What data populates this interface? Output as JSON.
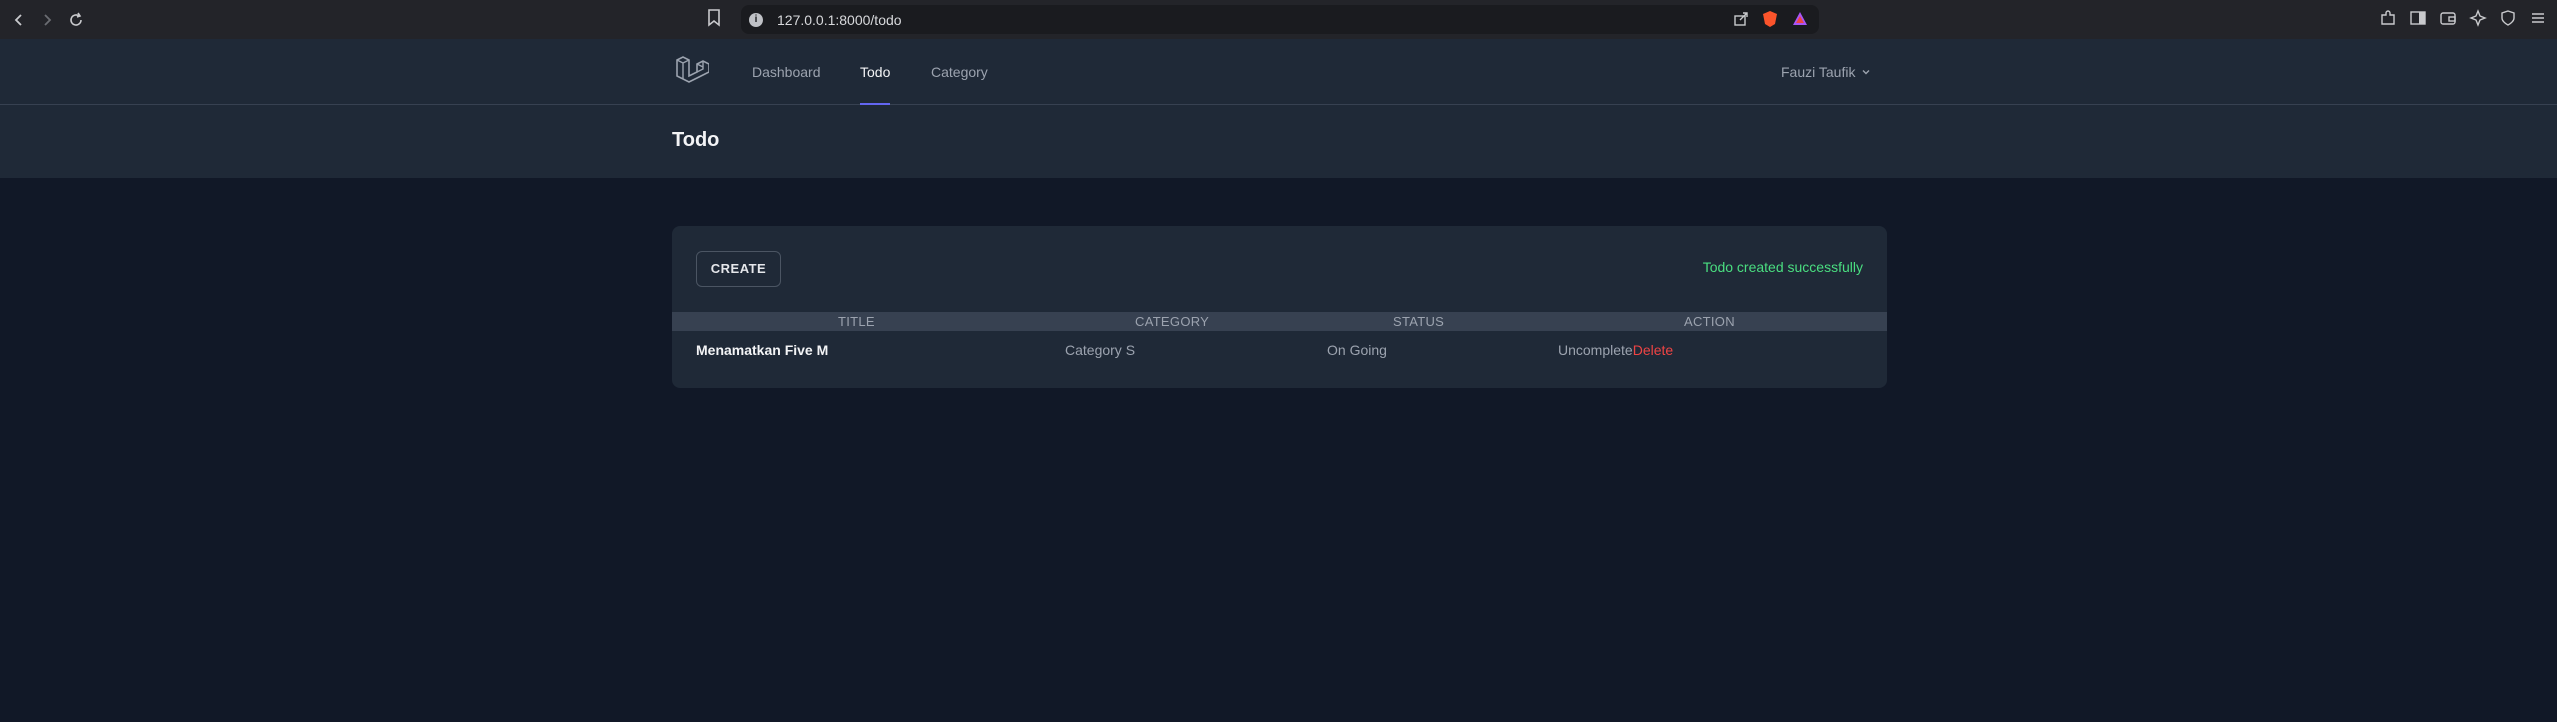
{
  "browser": {
    "url": "127.0.0.1:8000/todo"
  },
  "nav": {
    "links": [
      {
        "label": "Dashboard"
      },
      {
        "label": "Todo"
      },
      {
        "label": "Category"
      }
    ],
    "active": "Todo",
    "user": "Fauzi Taufik",
    "accent": "#6366f1"
  },
  "header": {
    "title": "Todo"
  },
  "card": {
    "create_label": "CREATE",
    "success_message": "Todo created successfully",
    "success_color": "#4ade80",
    "columns": [
      "TITLE",
      "CATEGORY",
      "STATUS",
      "ACTION"
    ],
    "rows": [
      {
        "title": "Menamatkan Five M",
        "category": "Category S",
        "status": "On Going",
        "action_complete": "Uncomplete",
        "action_delete": "Delete"
      }
    ],
    "delete_color": "#ef4444"
  }
}
